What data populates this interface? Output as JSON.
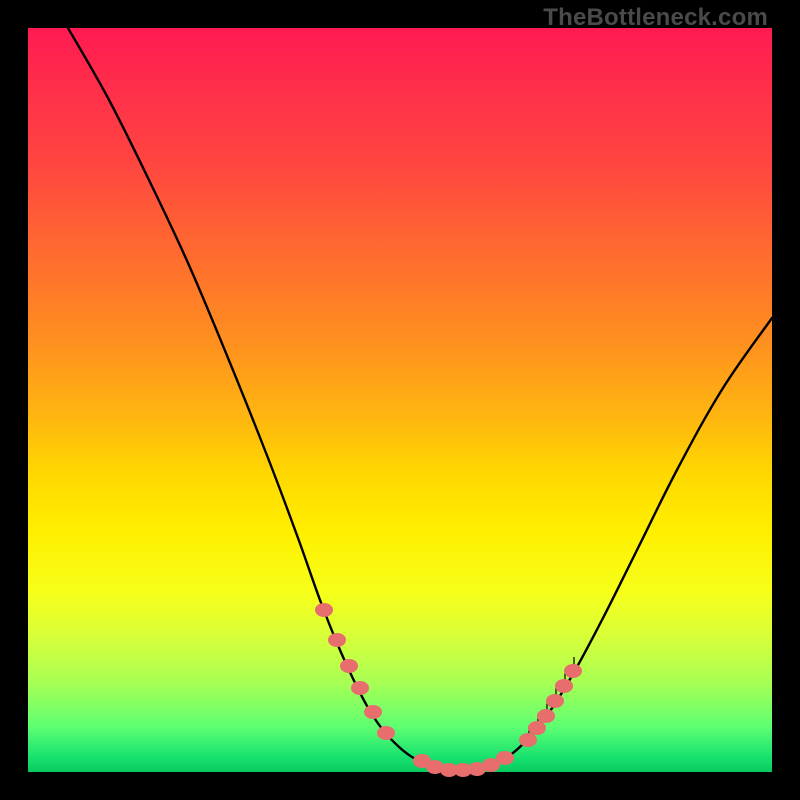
{
  "watermark": "TheBottleneck.com",
  "colors": {
    "curve": "#000000",
    "marker_fill": "#e86d6d",
    "marker_stroke": "#cc4f4f",
    "tick": "#000000"
  },
  "chart_data": {
    "type": "line",
    "title": "",
    "xlabel": "",
    "ylabel": "",
    "xlim": [
      0,
      744
    ],
    "ylim": [
      0,
      744
    ],
    "note": "Coordinates are in plot-area pixel space (origin top-left of the gradient panel). No axes or numeric tick labels are visible in the source image, so no real-world values can be read off; points below trace the visible curve shape.",
    "series": [
      {
        "name": "bottleneck-curve",
        "points": [
          [
            40,
            0
          ],
          [
            80,
            70
          ],
          [
            120,
            150
          ],
          [
            160,
            235
          ],
          [
            200,
            330
          ],
          [
            240,
            430
          ],
          [
            270,
            510
          ],
          [
            295,
            580
          ],
          [
            320,
            640
          ],
          [
            345,
            688
          ],
          [
            370,
            718
          ],
          [
            395,
            735
          ],
          [
            420,
            742
          ],
          [
            445,
            742
          ],
          [
            470,
            735
          ],
          [
            495,
            716
          ],
          [
            520,
            686
          ],
          [
            545,
            646
          ],
          [
            575,
            590
          ],
          [
            610,
            520
          ],
          [
            650,
            440
          ],
          [
            695,
            360
          ],
          [
            744,
            290
          ]
        ]
      }
    ],
    "markers": {
      "name": "highlight-dots",
      "rx": 9,
      "ry": 7,
      "points": [
        [
          296,
          582
        ],
        [
          309,
          612
        ],
        [
          321,
          638
        ],
        [
          332,
          660
        ],
        [
          345,
          684
        ],
        [
          358,
          705
        ],
        [
          394,
          733
        ],
        [
          407,
          739
        ],
        [
          421,
          742
        ],
        [
          435,
          742
        ],
        [
          449,
          741
        ],
        [
          463,
          737
        ],
        [
          477,
          730
        ],
        [
          500,
          712
        ],
        [
          509,
          700
        ],
        [
          518,
          688
        ],
        [
          527,
          673
        ],
        [
          536,
          658
        ],
        [
          545,
          643
        ]
      ]
    },
    "ticks": {
      "name": "small-vertical-ticks",
      "height": 16,
      "points": [
        [
          501,
          714
        ],
        [
          510,
          702
        ],
        [
          519,
          690
        ],
        [
          528,
          675
        ],
        [
          537,
          660
        ],
        [
          546,
          645
        ]
      ]
    }
  }
}
